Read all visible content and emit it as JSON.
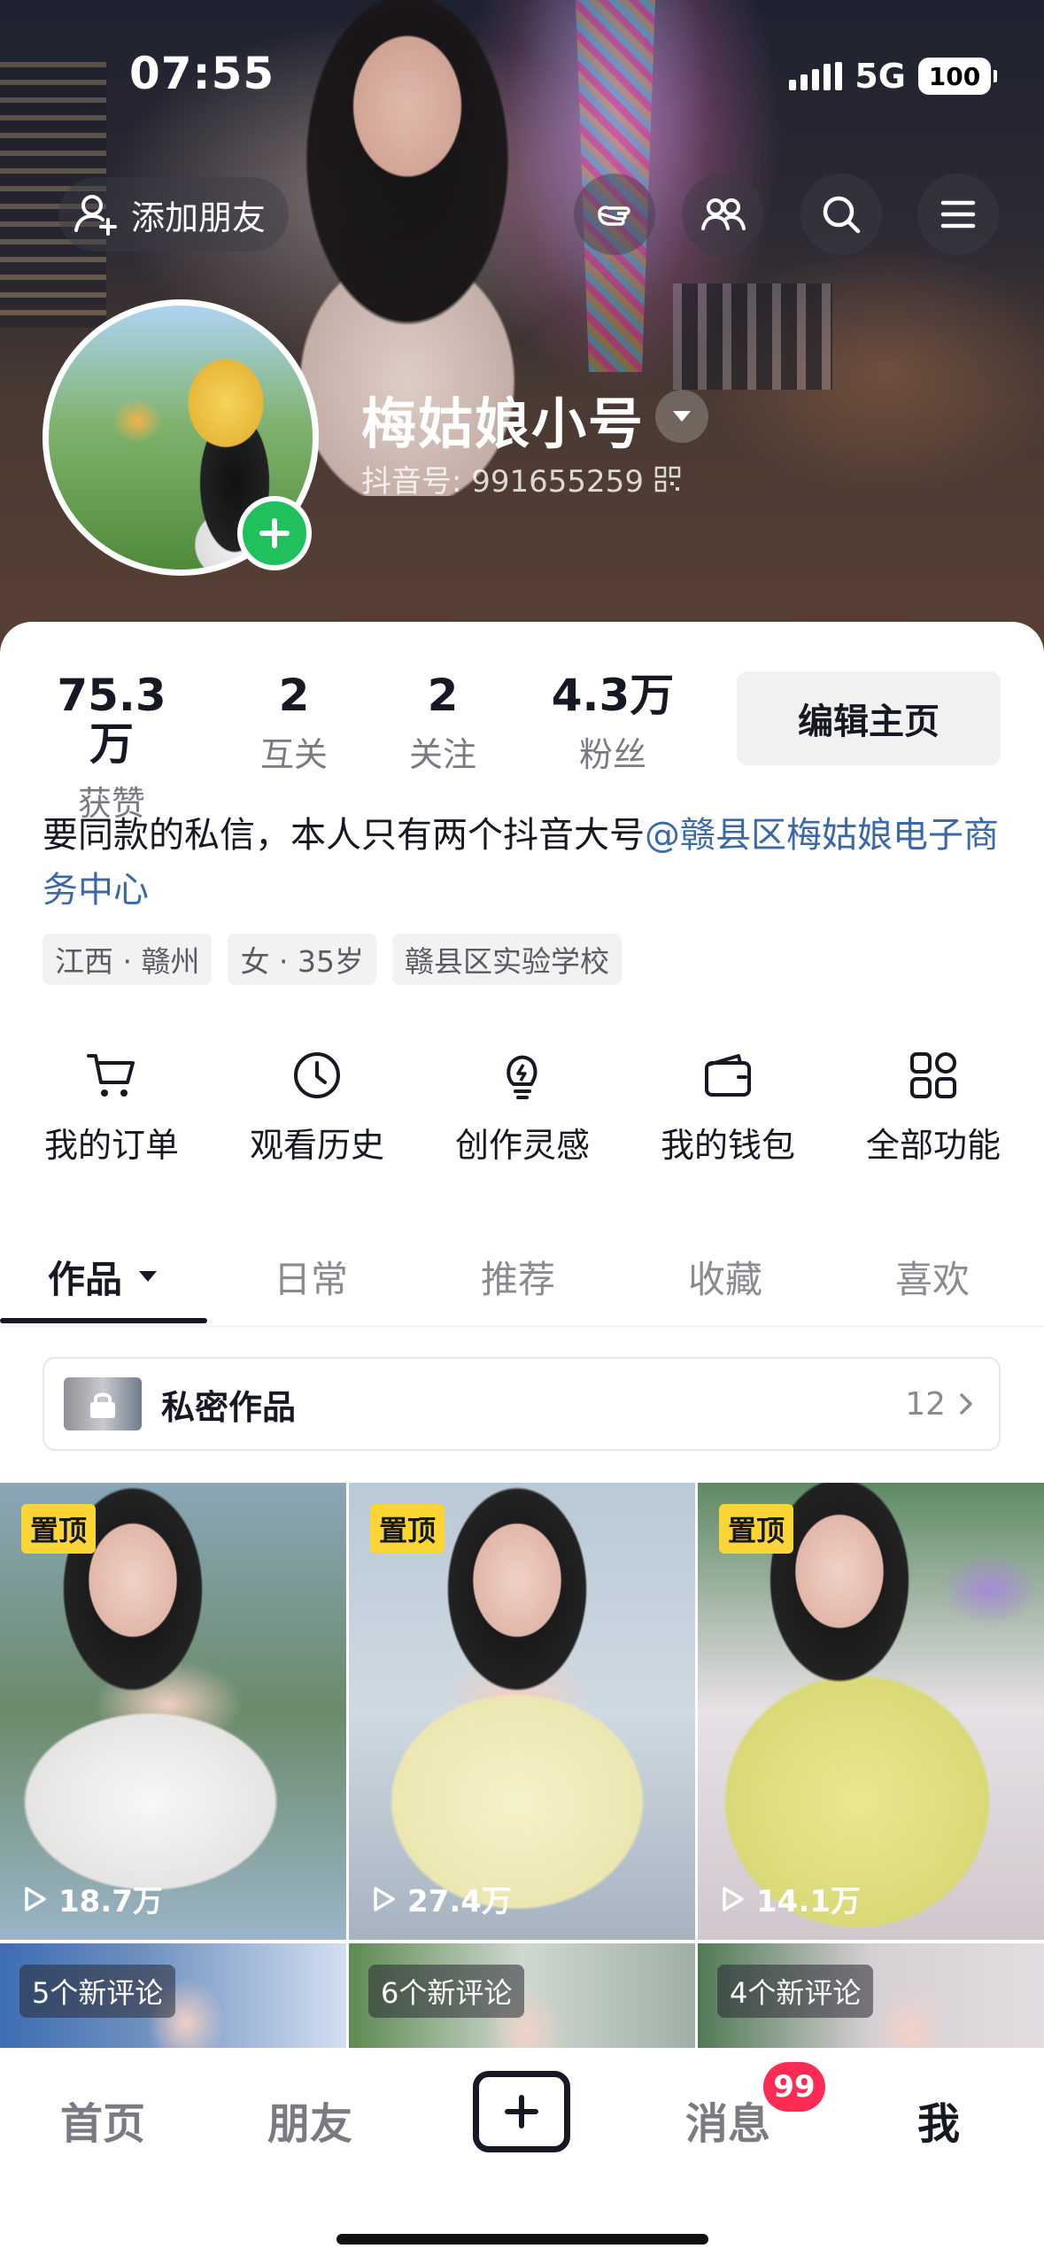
{
  "status_bar": {
    "time": "07:55",
    "network": "5G",
    "battery": "100"
  },
  "header": {
    "add_friend_label": "添加朋友",
    "nickname": "梅姑娘小号",
    "douyin_id": "抖音号: 991655259"
  },
  "stats": [
    {
      "value": "75.3万",
      "label": "获赞"
    },
    {
      "value": "2",
      "label": "互关"
    },
    {
      "value": "2",
      "label": "关注"
    },
    {
      "value": "4.3万",
      "label": "粉丝"
    }
  ],
  "edit_profile_label": "编辑主页",
  "bio": {
    "text": "要同款的私信，本人只有两个抖音大号",
    "mention_line1": "@赣县区梅姑娘电",
    "mention_line2": "子商务中心"
  },
  "tags": [
    "江西 · 赣州",
    "女 · 35岁",
    "赣县区实验学校"
  ],
  "tools": [
    {
      "label": "我的订单",
      "icon": "cart-icon"
    },
    {
      "label": "观看历史",
      "icon": "clock-icon"
    },
    {
      "label": "创作灵感",
      "icon": "lightbulb-icon"
    },
    {
      "label": "我的钱包",
      "icon": "wallet-icon"
    },
    {
      "label": "全部功能",
      "icon": "grid-icon"
    }
  ],
  "tabs": [
    "作品",
    "日常",
    "推荐",
    "收藏",
    "喜欢"
  ],
  "private_works": {
    "label": "私密作品",
    "count": "12"
  },
  "videos": [
    {
      "pin": "置顶",
      "views": "18.7万"
    },
    {
      "pin": "置顶",
      "views": "27.4万"
    },
    {
      "pin": "置顶",
      "views": "14.1万"
    }
  ],
  "videos_row2": [
    {
      "badge": "5个新评论"
    },
    {
      "badge": "6个新评论"
    },
    {
      "badge": "4个新评论"
    }
  ],
  "bottom_nav": {
    "home": "首页",
    "friends": "朋友",
    "messages": "消息",
    "messages_badge": "99",
    "me": "我"
  },
  "colors": {
    "accent": "#fe2c55",
    "link": "#3a68a8",
    "pin": "#fbd535",
    "plus_green": "#20c05c"
  }
}
